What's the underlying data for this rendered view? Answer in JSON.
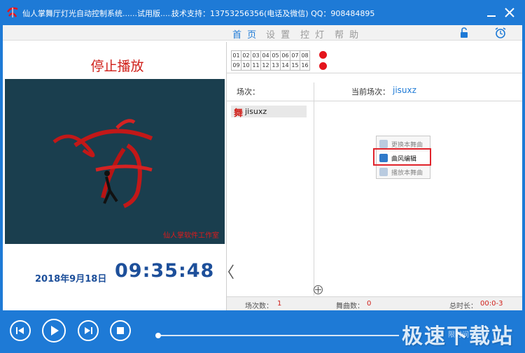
{
  "app": {
    "title": "仙人掌舞厅灯光自动控制系统......试用版......",
    "support": "技术支持：13753256356(电话及微信)   QQ：908484895"
  },
  "menu": {
    "items": [
      {
        "label": "首 页",
        "active": true
      },
      {
        "label": "设 置",
        "active": false
      },
      {
        "label": "控 灯",
        "active": false
      },
      {
        "label": "帮 助",
        "active": false
      }
    ],
    "icons": [
      "lock-icon",
      "alarm-clock-icon"
    ]
  },
  "left": {
    "status": "停止播放",
    "watermark": "仙人掌软件工作室",
    "date": "2018年9月18日",
    "clock": "09:35:48",
    "collapse_glyph": "〈"
  },
  "channels": {
    "row1": [
      "01",
      "02",
      "03",
      "04",
      "05",
      "06",
      "07",
      "08"
    ],
    "row2": [
      "09",
      "10",
      "11",
      "12",
      "13",
      "14",
      "15",
      "16"
    ],
    "indicator_color": "#e4141c"
  },
  "scene": {
    "label": "场次：",
    "current_label": "当前场次：",
    "current_value": "jisuxz",
    "items": [
      "jisuxz"
    ]
  },
  "context_menu": {
    "items": [
      {
        "label": "更换本舞曲"
      },
      {
        "label": "曲风编辑"
      },
      {
        "label": "播放本舞曲"
      }
    ]
  },
  "statusbar": {
    "scene_count_label": "场次数：",
    "scene_count": "1",
    "song_count_label": "舞曲数：",
    "song_count": "0",
    "duration_label": "总时长：",
    "duration": "00:0-3"
  },
  "player": {
    "buttons": [
      "previous-button",
      "play-button",
      "next-button",
      "stop-button"
    ],
    "time_label": "限时间",
    "watermark": "极速下载站"
  },
  "colors": {
    "accent": "#1e7ad6",
    "alert": "#d0201a",
    "clock": "#1d4f9a"
  }
}
